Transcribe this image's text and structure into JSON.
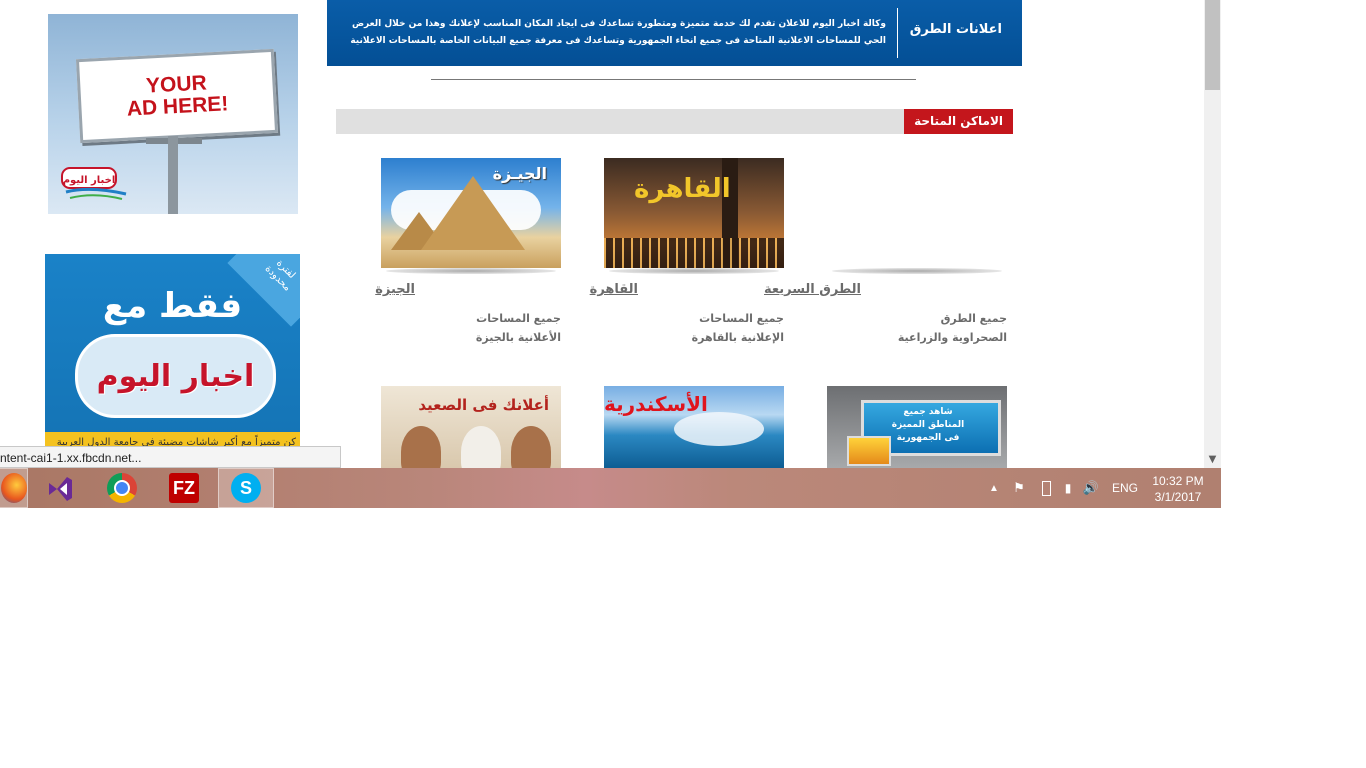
{
  "ads": {
    "billboard_text": "YOUR\nAD HERE!",
    "logo_text": "اخبار اليوم",
    "promo_only": "فقط مع",
    "promo_brand": "اخبار اليوم",
    "promo_corner": "لفترة محدودة",
    "promo_strip": "كن متميزاً مع أكبر شاشات مضيئة في جامعة الدول العربية"
  },
  "header": {
    "title": "اعلانات الطرق",
    "description": "وكالة اخبار اليوم للاعلان تقدم لك خدمة متميزة ومتطورة تساعدك فى ايجاد المكان المناسب لإعلانك وهذا من خلال العرض الحي للمساحات الاعلانية المتاحة فى جميع انحاء الجمهورية وتساعدك فى معرفة جميع البيانات الخاصة بالمساحات الاعلانية"
  },
  "section": {
    "label": "الاماكن المتاحة"
  },
  "locations": [
    {
      "image_caption": "الجيـزة",
      "title": "الجيزة",
      "line1": "جميع المساحات",
      "line2": "الأعلانية بالجيزة"
    },
    {
      "image_caption": "القاهرة",
      "title": "القاهرة",
      "line1": "جميع المساحات",
      "line2": "الإعلانية بالقاهرة"
    },
    {
      "title": "الطرق السريعة",
      "line1": "جميع الطرق",
      "line2": "الصحراوية والزراعية"
    }
  ],
  "row2": [
    {
      "image_caption": "أعلانك فى الصعيد"
    },
    {
      "image_caption": "الأسكندرية"
    },
    {
      "panel_text": "شاهد جميع\nالمناطق المميزة\nفى الجمهورية"
    }
  ],
  "status_url": "ntent-cai1-1.xx.fbcdn.net...",
  "taskbar": {
    "apps": [
      "firefox-icon",
      "visual-studio-icon",
      "chrome-icon",
      "filezilla-icon",
      "skype-icon"
    ],
    "lang": "ENG",
    "time": "10:32 PM",
    "date": "3/1/2017"
  },
  "colors": {
    "header_blue": "#034f95",
    "section_red": "#c4161c",
    "text_gray": "#6b6b6b"
  }
}
